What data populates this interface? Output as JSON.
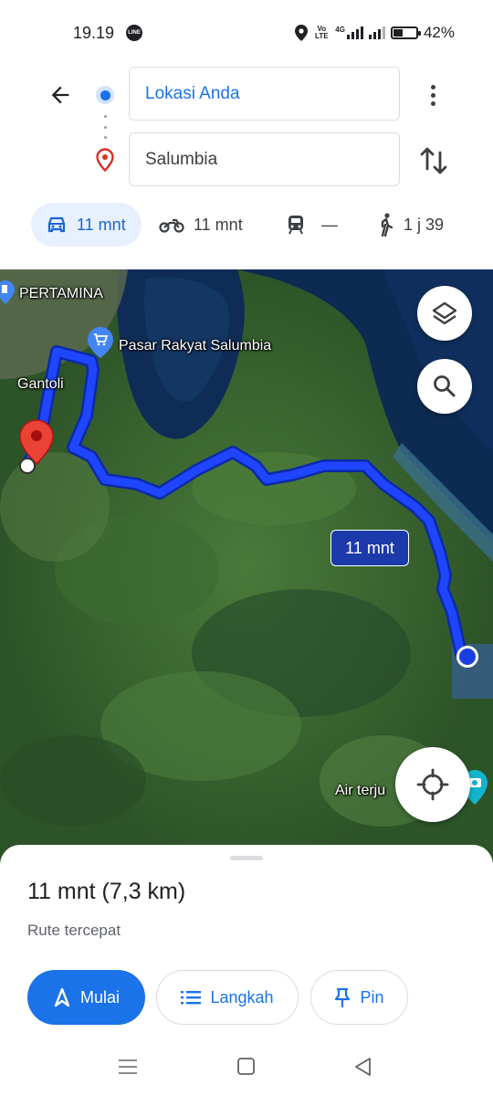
{
  "status_bar": {
    "time": "19.19",
    "battery_percent": "42%",
    "battery_level": 0.42,
    "net_volte": "Vo LTE",
    "net_4g": "4G",
    "icons": [
      "line-icon",
      "location-icon",
      "volte-icon",
      "signal-4g-icon",
      "signal-icon",
      "battery-icon"
    ]
  },
  "search": {
    "origin": "Lokasi Anda",
    "destination": "Salumbia"
  },
  "modes": [
    {
      "name": "car",
      "label": "11 mnt",
      "selected": true
    },
    {
      "name": "motorcycle",
      "label": "11 mnt",
      "selected": false
    },
    {
      "name": "transit",
      "label": "—",
      "selected": false
    },
    {
      "name": "walk",
      "label": "1 j 39",
      "selected": false
    }
  ],
  "map": {
    "labels": {
      "pertamina": "PERTAMINA",
      "pasar": "Pasar Rakyat Salumbia",
      "gantoli": "Gantoli",
      "air_terjun": "Air terju"
    },
    "route_badge": "11 mnt",
    "route_color": "#1a3fe0"
  },
  "sheet": {
    "summary": "11 mnt (7,3 km)",
    "subtitle": "Rute tercepat",
    "buttons": {
      "start": "Mulai",
      "steps": "Langkah",
      "pin": "Pin"
    }
  },
  "colors": {
    "accent": "#1a73e8",
    "dest_pin": "#d93025"
  }
}
